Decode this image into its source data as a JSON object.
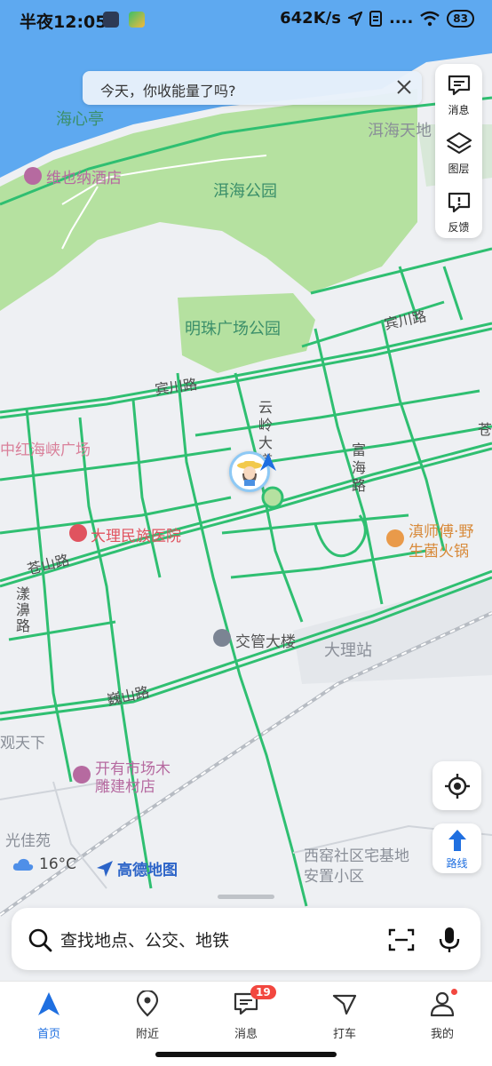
{
  "status_bar": {
    "time": "半夜12:05",
    "net_speed": "642K/s",
    "signal_dots": "....",
    "battery": "83"
  },
  "notice": {
    "text": "今天，你收能量了吗?"
  },
  "side_toolbar": {
    "items": [
      {
        "label": "消息",
        "icon": "message-icon"
      },
      {
        "label": "图层",
        "icon": "layers-icon"
      },
      {
        "label": "反馈",
        "icon": "feedback-icon"
      }
    ]
  },
  "map": {
    "labels": {
      "haixinting": "海心亭",
      "erhaitian": "洱海天地",
      "weiyena": "维也纳酒店",
      "erhai_park": "洱海公园",
      "mingzhu_park": "明珠广场公园",
      "binchuan_1": "宾川路",
      "binchuan_2": "宾川路",
      "hongshan": "中红海峡广场",
      "yunling": "云岭大道",
      "fuhai": "富海路",
      "hospital": "大理民族医院",
      "cangshan": "苍山路",
      "yangbi": "漾濞路",
      "jiaoguan": "交管大楼",
      "dali_station": "大理站",
      "weishan": "巍山路",
      "guantianxia": "观天下",
      "kaiyou": "开有市场木雕建材店",
      "guangjia": "光佳苑",
      "xiyao": "西窑社区宅基地安置小区",
      "hotpot": "滇师傅·野生菌火锅",
      "cang_right": "苍"
    }
  },
  "locate_button": {
    "icon": "locate-icon"
  },
  "route_button": {
    "label": "路线",
    "icon": "route-arrow-icon"
  },
  "weather": {
    "temp": "16°C",
    "icon": "cloud-icon"
  },
  "brand": {
    "name": "高德地图"
  },
  "search": {
    "placeholder": "查找地点、公交、地铁"
  },
  "nav": {
    "items": [
      {
        "label": "首页",
        "icon": "home-arrow-icon"
      },
      {
        "label": "附近",
        "icon": "pin-icon"
      },
      {
        "label": "消息",
        "icon": "chat-icon",
        "badge": "19"
      },
      {
        "label": "打车",
        "icon": "taxi-icon"
      },
      {
        "label": "我的",
        "icon": "person-icon"
      }
    ]
  },
  "colors": {
    "road": "#2fbf71",
    "park": "#b5e1a0",
    "water": "#5ea9f0",
    "accent": "#1f6fe0"
  }
}
